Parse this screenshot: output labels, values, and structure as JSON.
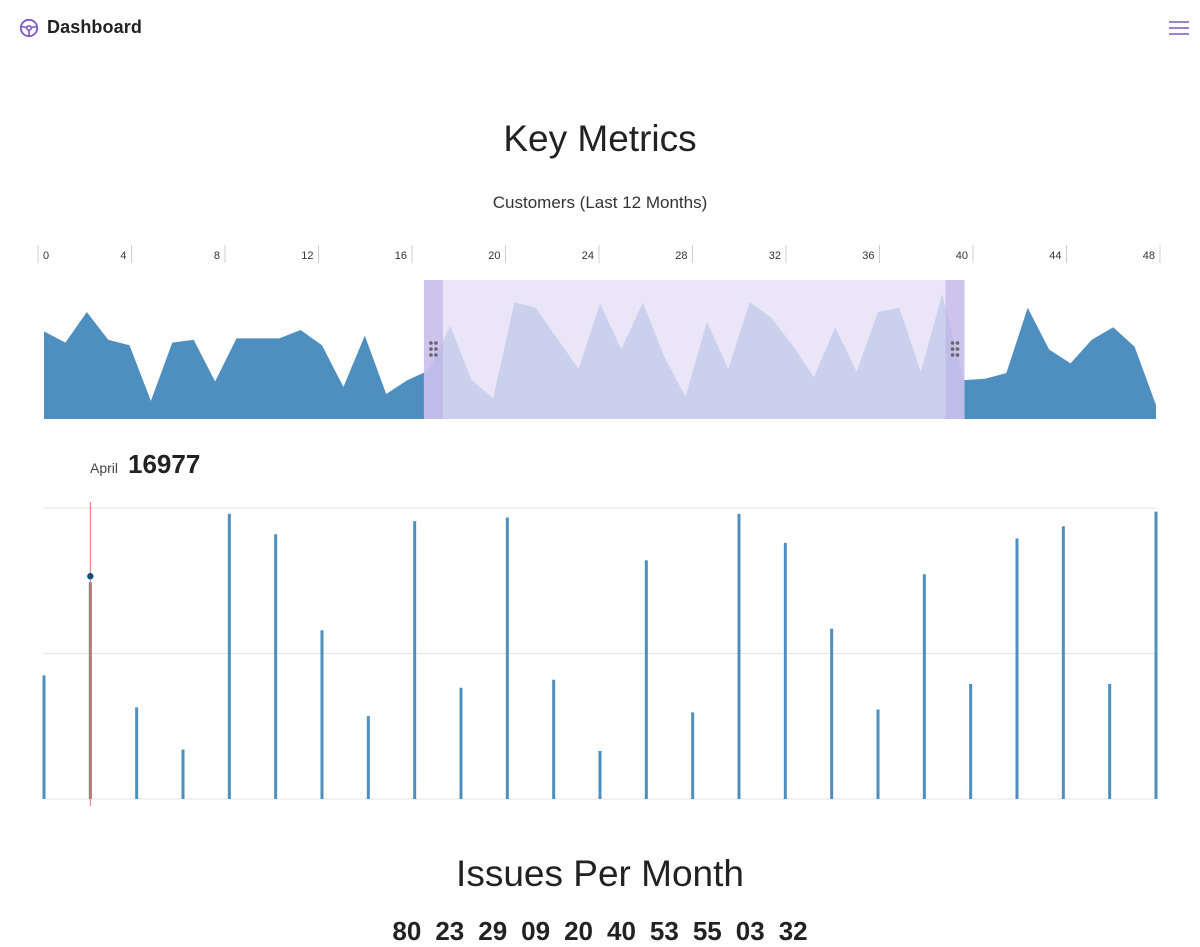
{
  "header": {
    "title": "Dashboard",
    "logo_icon": "steering-wheel-icon",
    "menu_icon": "hamburger-menu-icon"
  },
  "colors": {
    "accent": "#7e57c2",
    "series": "#4f8fbf",
    "brush": "#e6dff7",
    "brush_handle": "#b9ade6",
    "cursor": "#e57373"
  },
  "page": {
    "title": "Key Metrics"
  },
  "customers": {
    "title": "Customers (Last 12 Months)",
    "axis_ticks": [
      "0",
      "4",
      "8",
      "12",
      "16",
      "20",
      "24",
      "28",
      "32",
      "36",
      "40",
      "44",
      "48"
    ],
    "readout_label": "April",
    "readout_value": "16977"
  },
  "issues": {
    "title": "Issues Per Month",
    "values": [
      "80",
      "23",
      "29",
      "09",
      "20",
      "40",
      "53",
      "55",
      "03",
      "32"
    ]
  },
  "chart_data": [
    {
      "type": "area",
      "title": "Customers (Last 12 Months)",
      "x": [
        0,
        1,
        2,
        3,
        4,
        5,
        6,
        7,
        8,
        9,
        10,
        11,
        12,
        13,
        14,
        15,
        16,
        17,
        18,
        19,
        20,
        21,
        22,
        23,
        24,
        25,
        26,
        27,
        28,
        29,
        30,
        31,
        32,
        33,
        34,
        35,
        36,
        37,
        38,
        39,
        40,
        41,
        42,
        43,
        44,
        45,
        46,
        47,
        48,
        49,
        50,
        51
      ],
      "values": [
        63,
        55,
        77,
        57,
        53,
        13,
        55,
        57,
        27,
        58,
        58,
        58,
        64,
        53,
        23,
        60,
        18,
        28,
        35,
        67,
        28,
        15,
        84,
        80,
        58,
        36,
        83,
        50,
        84,
        45,
        16,
        70,
        36,
        84,
        73,
        53,
        30,
        66,
        34,
        77,
        80,
        34,
        90,
        28,
        29,
        33,
        80,
        50,
        40,
        57,
        66,
        52,
        10
      ],
      "brush_range": [
        18,
        43
      ],
      "axis_ticks": [
        0,
        4,
        8,
        12,
        16,
        20,
        24,
        28,
        32,
        36,
        40,
        44,
        48
      ],
      "grid": false
    },
    {
      "type": "bar",
      "title": "",
      "values": [
        17000,
        29800,
        12600,
        6800,
        39200,
        36400,
        23200,
        11400,
        38200,
        15300,
        38700,
        16400,
        6600,
        32800,
        11900,
        39200,
        35200,
        23400,
        12300,
        30900,
        15800,
        35800,
        37500,
        15800,
        39500
      ],
      "highlight_index": 1,
      "highlight_label": "April",
      "highlight_value": 16977,
      "ylim": [
        0,
        40000
      ],
      "grid": true
    }
  ]
}
